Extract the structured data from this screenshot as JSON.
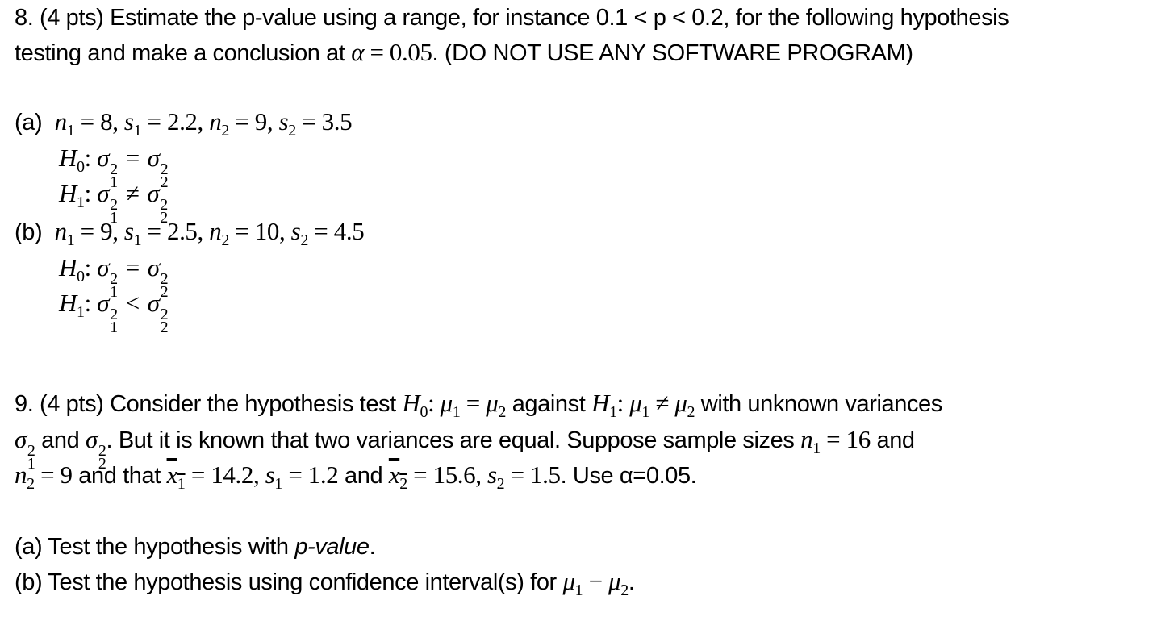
{
  "q8": {
    "line1": "8. (4 pts) Estimate the p-value using a range, for instance 0.1 < p < 0.2, for the following hypothesis",
    "line2_prefix": "testing and make a conclusion at ",
    "alpha_sym": "α",
    "alpha_eq": " = 0.05",
    "line2_suffix": ". (DO NOT USE ANY SOFTWARE PROGRAM)",
    "parts": [
      {
        "label": "(a)",
        "n1": "8",
        "s1": "2.2",
        "n2": "9",
        "s2": "3.5",
        "h0_rel": "=",
        "h1_rel": "≠"
      },
      {
        "label": "(b)",
        "n1": "9",
        "s1": "2.5",
        "n2": "10",
        "s2": "4.5",
        "h0_rel": "=",
        "h1_rel": "<"
      }
    ]
  },
  "q9": {
    "line1_prefix": "9. (4 pts) Consider the hypothesis test ",
    "line1_mid": " against ",
    "line1_suffix": " with unknown variances",
    "line2_and": " and ",
    "line2_text": ". But it is known that two variances are equal. Suppose sample sizes ",
    "n1": "16",
    "line2_end": " and",
    "n2": "9",
    "line3_and_that": " and that ",
    "x1bar": "14.2",
    "s1": "1.2",
    "and": " and ",
    "x2bar": "15.6",
    "s2": "1.5",
    "use_alpha": ". Use α=0.05.",
    "part_a_prefix": "(a) Test the hypothesis with ",
    "part_a_italic": "p-value",
    "part_a_suffix": ".",
    "part_b_text": "(b) Test the hypothesis using confidence interval(s) for ",
    "part_b_end": "."
  }
}
